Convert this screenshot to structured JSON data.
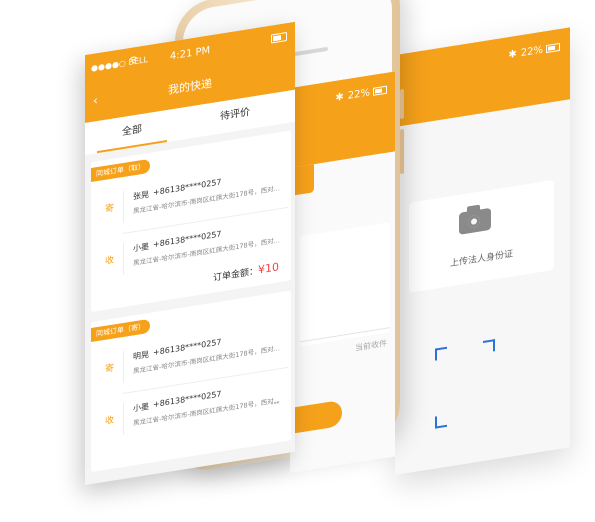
{
  "back_screen": {
    "battery": "22%",
    "upload_label": "上传法人身份证"
  },
  "mid_screen": {
    "battery": "22%",
    "hint": "当前收件"
  },
  "front_screen": {
    "carrier": "BELL",
    "time": "4:21 PM",
    "title": "我的快递",
    "tabs": [
      {
        "label": "全部",
        "active": true
      },
      {
        "label": "待评价",
        "active": false
      }
    ],
    "orders": [
      {
        "tag": "同城订单（取）",
        "sender": {
          "badge": "寄",
          "name": "张晃",
          "phone": "+86138****0257",
          "address": "黑龙江省-哈尔滨市-南岗区红旗大街178号，西对..."
        },
        "receiver": {
          "badge": "收",
          "name": "小墨",
          "phone": "+86138****0257",
          "address": "黑龙江省-哈尔滨市-南岗区红旗大街178号，西对..."
        },
        "total_label": "订单金额：",
        "total_amount": "¥10"
      },
      {
        "tag": "同城订单（寄）",
        "sender": {
          "badge": "寄",
          "name": "明晃",
          "phone": "+86138****0257",
          "address": "黑龙江省-哈尔滨市-南岗区红旗大街178号，西对..."
        },
        "receiver": {
          "badge": "收",
          "name": "小墨",
          "phone": "+86138****0257",
          "address": "黑龙江省-哈尔滨市-南岗区红旗大街178号，西对..."
        }
      }
    ]
  },
  "colors": {
    "accent": "#f6a11a",
    "price": "#f04848"
  }
}
